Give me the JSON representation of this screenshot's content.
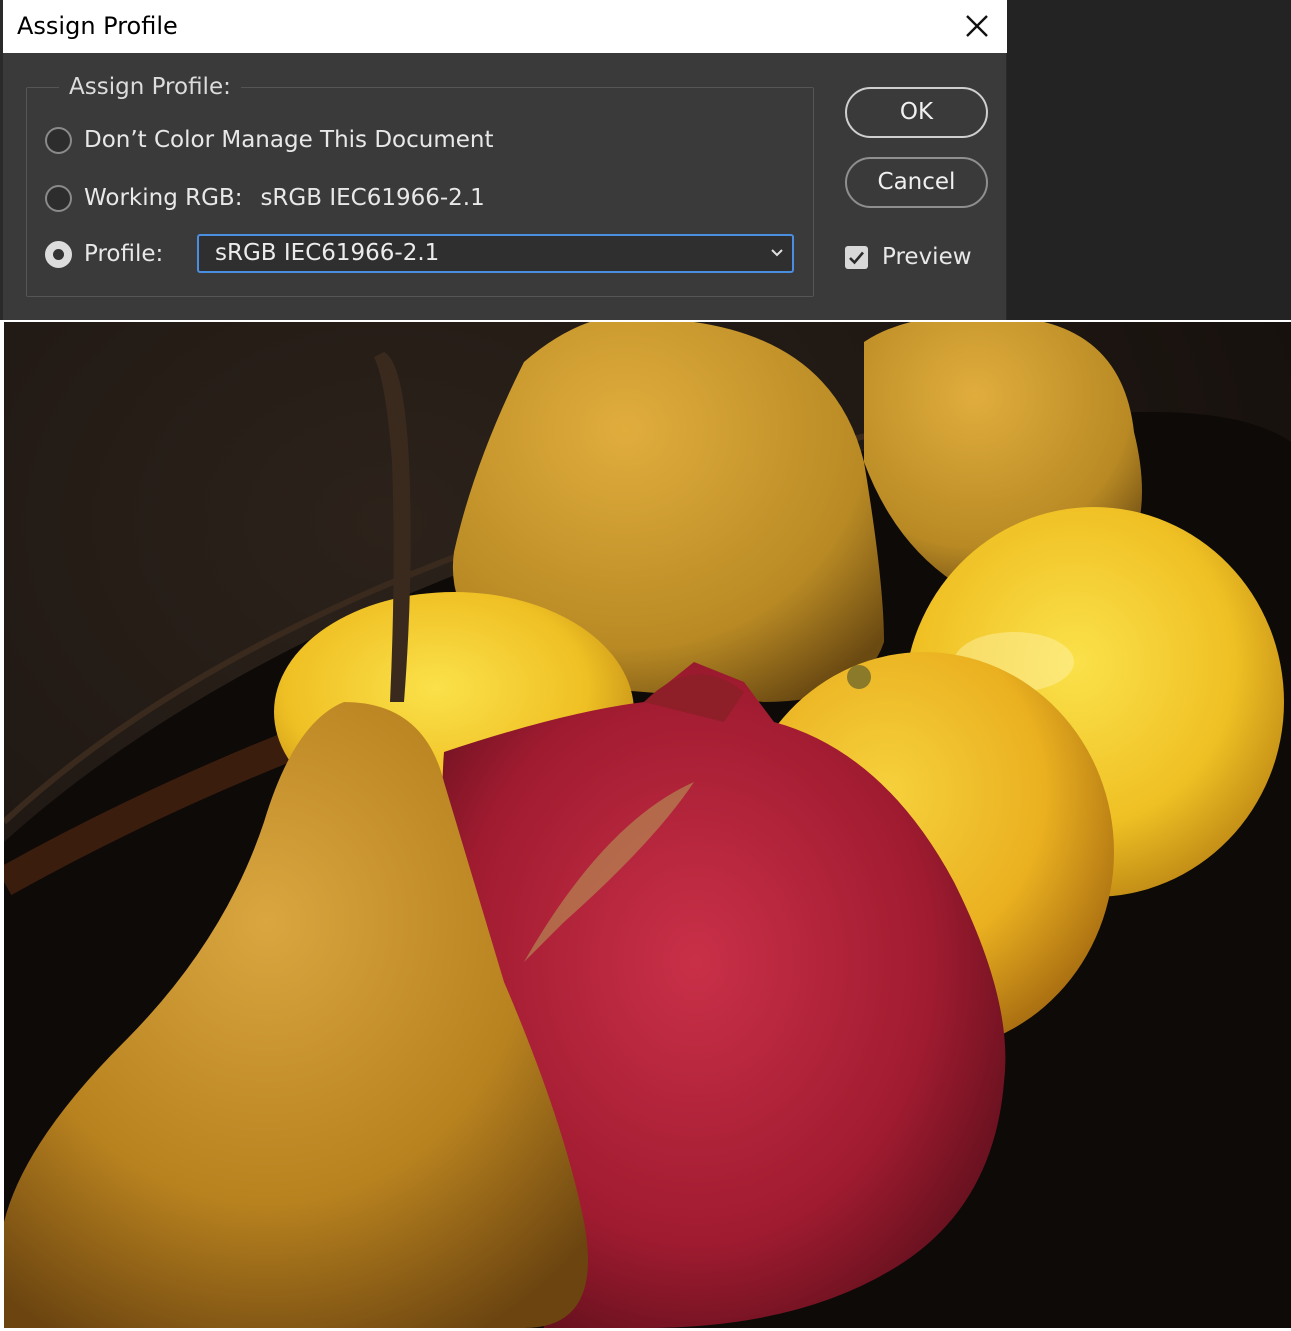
{
  "dialog": {
    "title": "Assign Profile",
    "group_title": "Assign Profile:",
    "options": [
      {
        "label": "Don’t Color Manage This Document",
        "selected": false
      },
      {
        "label": "Working RGB:",
        "value": "sRGB IEC61966-2.1",
        "selected": false
      },
      {
        "label": "Profile:",
        "selected": true
      }
    ],
    "profile_select": {
      "value": "sRGB IEC61966-2.1"
    },
    "buttons": {
      "ok": "OK",
      "cancel": "Cancel"
    },
    "preview": {
      "label": "Preview",
      "checked": true
    }
  },
  "icons": [
    "close-icon",
    "chevron-down-icon",
    "checkmark-icon"
  ],
  "colors": {
    "dialog_bg": "#3a3a3a",
    "focus_border": "#4a8ee0",
    "app_bg": "#232323"
  }
}
